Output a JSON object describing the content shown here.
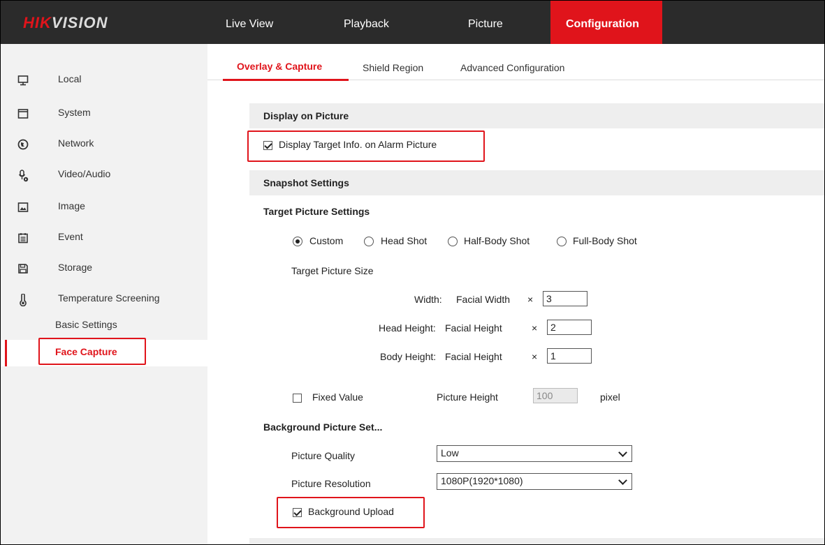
{
  "brand": {
    "part1": "HIK",
    "part2": "VISION"
  },
  "nav": [
    {
      "label": "Live View"
    },
    {
      "label": "Playback"
    },
    {
      "label": "Picture"
    },
    {
      "label": "Configuration"
    }
  ],
  "sidebar": {
    "items": [
      {
        "label": "Local",
        "icon": "monitor-icon"
      },
      {
        "label": "System",
        "icon": "window-icon"
      },
      {
        "label": "Network",
        "icon": "globe-icon"
      },
      {
        "label": "Video/Audio",
        "icon": "microphone-icon"
      },
      {
        "label": "Image",
        "icon": "image-icon"
      },
      {
        "label": "Event",
        "icon": "calendar-icon"
      },
      {
        "label": "Storage",
        "icon": "floppy-icon"
      },
      {
        "label": "Temperature Screening",
        "icon": "thermometer-icon"
      }
    ],
    "sub_items": [
      {
        "label": "Basic Settings"
      },
      {
        "label": "Face Capture"
      }
    ]
  },
  "tabs": [
    {
      "label": "Overlay & Capture"
    },
    {
      "label": "Shield Region"
    },
    {
      "label": "Advanced Configuration"
    }
  ],
  "display_section": {
    "title": "Display on Picture",
    "target_info_label": "Display Target Info. on Alarm Picture"
  },
  "snapshot_section": {
    "title": "Snapshot Settings"
  },
  "target_picture": {
    "title": "Target Picture Settings",
    "modes": [
      {
        "label": "Custom"
      },
      {
        "label": "Head Shot"
      },
      {
        "label": "Half-Body Shot"
      },
      {
        "label": "Full-Body Shot"
      }
    ],
    "size_title": "Target Picture Size",
    "width_label": "Width:",
    "width_unit": "Facial Width",
    "width_value": "3",
    "head_label": "Head Height:",
    "head_unit": "Facial Height",
    "head_value": "2",
    "body_label": "Body Height:",
    "body_unit": "Facial Height",
    "body_value": "1",
    "times": "×",
    "fixed_value_label": "Fixed Value",
    "picture_height_label": "Picture Height",
    "picture_height_value": "100",
    "pixel_label": "pixel"
  },
  "background_picture": {
    "title": "Background Picture Set...",
    "quality_label": "Picture Quality",
    "quality_value": "Low",
    "resolution_label": "Picture Resolution",
    "resolution_value": "1080P(1920*1080)",
    "upload_label": "Background Upload"
  },
  "colors": {
    "accent": "#e0141b",
    "topbar": "#2b2b2b",
    "sidebar": "#f2f2f2",
    "section": "#eeeeee"
  }
}
